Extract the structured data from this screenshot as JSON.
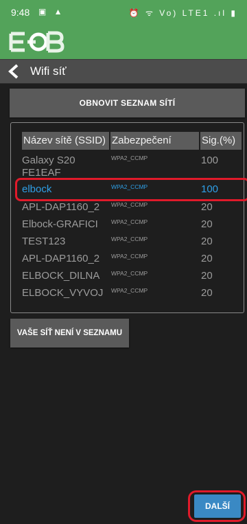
{
  "status": {
    "time": "9:48",
    "left_icons": "▣ ▲",
    "right_icons": "⏰ ᯤ Vo) LTE1 .ıl ▮"
  },
  "header": {
    "title": "Wifi síť"
  },
  "refresh_label": "OBNOVIT SEZNAM SÍTÍ",
  "table": {
    "headers": {
      "ssid": "Název sítě (SSID)",
      "security": "Zabezpečení",
      "signal": "Sig.(%)"
    },
    "rows": [
      {
        "ssid": "Galaxy S20 FE1EAF",
        "security": "WPA2_CCMP",
        "signal": "100"
      },
      {
        "ssid": "elbock",
        "security": "WPA2_CCMP",
        "signal": "100"
      },
      {
        "ssid": "APL-DAP1160_2",
        "security": "WPA2_CCMP",
        "signal": "20"
      },
      {
        "ssid": "Elbock-GRAFICI",
        "security": "WPA2_CCMP",
        "signal": "20"
      },
      {
        "ssid": "TEST123",
        "security": "WPA2_CCMP",
        "signal": "20"
      },
      {
        "ssid": "APL-DAP1160_2",
        "security": "WPA2_CCMP",
        "signal": "20"
      },
      {
        "ssid": "ELBOCK_DILNA",
        "security": "WPA2_CCMP",
        "signal": "20"
      },
      {
        "ssid": "ELBOCK_VYVOJ",
        "security": "WPA2_CCMP",
        "signal": "20"
      }
    ],
    "selected_ssid": "elbock"
  },
  "not_listed_label": "VAŠE SÍŤ NENÍ V SEZNAMU",
  "next_label": "DALŠÍ",
  "colors": {
    "brand_green": "#53a35a",
    "selected_blue": "#2f9fe6",
    "highlight_red": "#e01a2a",
    "next_blue": "#3a89c4"
  }
}
